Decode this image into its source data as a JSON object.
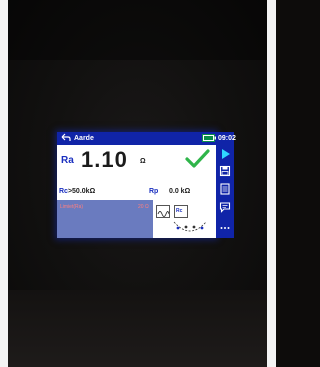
{
  "header": {
    "title": "Aarde",
    "time": "09:02"
  },
  "result": {
    "ra_label": "Ra",
    "ra_value": "1.10",
    "ra_unit": "Ω"
  },
  "sub": {
    "rc_label": "Rc",
    "rc_value": ">50.0",
    "rc_unit": "kΩ",
    "rp_label": "Rp",
    "rp_value": "0.0 kΩ"
  },
  "limit": {
    "label": "Limiet(Ra)",
    "value": "20 Ω"
  },
  "icons": {
    "rc_icon_text": "Rc"
  },
  "colors": {
    "accent": "#1024a8",
    "pass": "#2fb54a",
    "limit_panel": "#6a7bbf"
  }
}
